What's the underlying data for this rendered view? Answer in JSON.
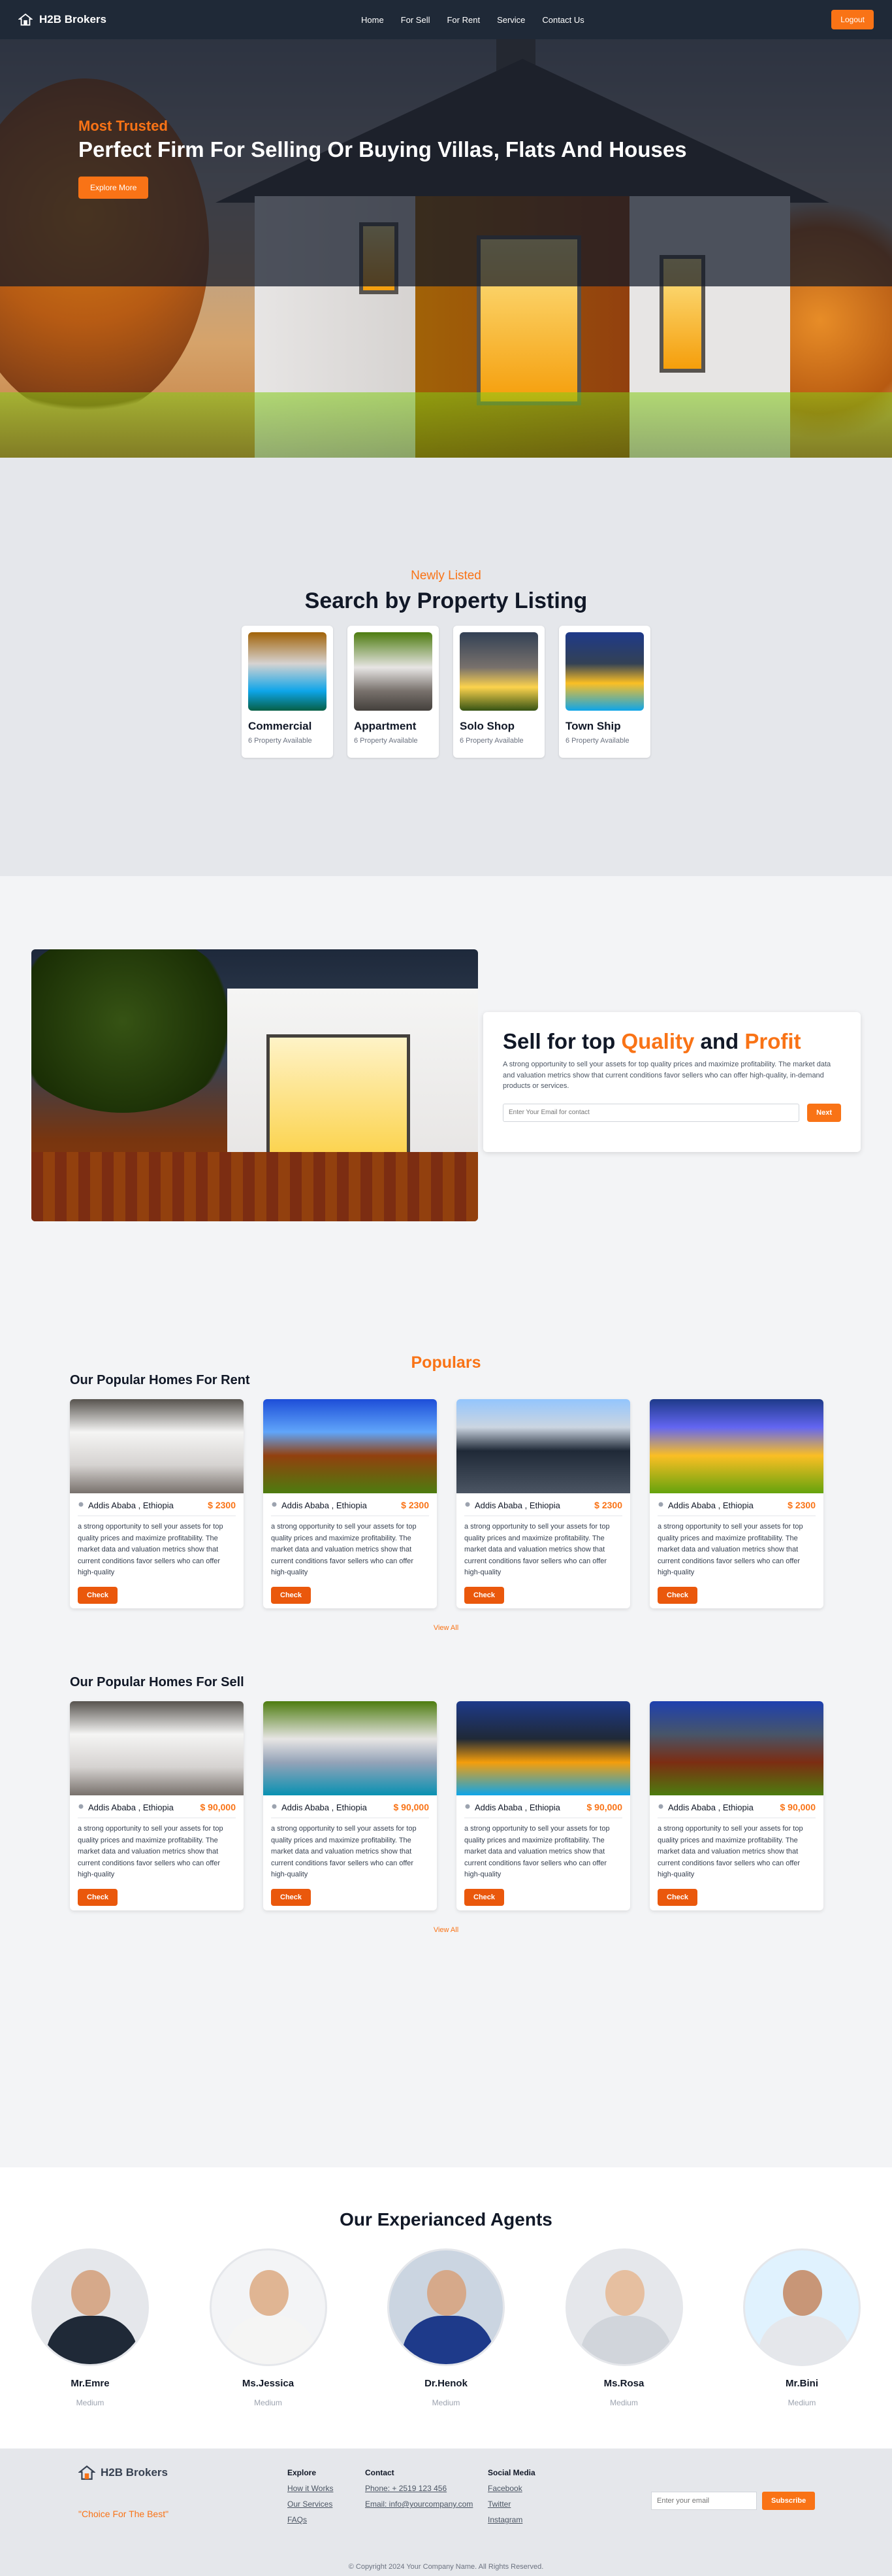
{
  "nav": {
    "brand": "H2B Brokers",
    "links": [
      "Home",
      "For Sell",
      "For Rent",
      "Service",
      "Contact Us"
    ],
    "logout": "Logout"
  },
  "hero": {
    "kicker": "Most Trusted",
    "title": "Perfect Firm For Selling Or Buying Villas, Flats And Houses",
    "cta": "Explore More"
  },
  "listing": {
    "kicker": "Newly Listed",
    "title": "Search by Property Listing",
    "categories": [
      {
        "name": "Commercial",
        "count": "6 Property Available"
      },
      {
        "name": "Appartment",
        "count": "6 Property Available"
      },
      {
        "name": "Solo Shop",
        "count": "6 Property Available"
      },
      {
        "name": "Town Ship",
        "count": "6 Property Available"
      }
    ]
  },
  "sell": {
    "title_a": "Sell for top ",
    "title_b": "Quality",
    "title_c": " and ",
    "title_d": "Profit",
    "text": "A strong opportunity to sell your assets for top quality prices and maximize profitability. The market data and valuation metrics show that current conditions favor sellers who can offer high-quality, in-demand products or services.",
    "placeholder": "Enter Your Email for contact",
    "button": "Next"
  },
  "populars": {
    "title": "Populars",
    "rent_title": "Our Popular Homes For Rent",
    "sell_title": "Our Popular Homes For Sell",
    "view_all": "View All",
    "desc": "a strong opportunity to sell your assets for top quality prices and maximize profitability. The market data and valuation metrics show that current conditions favor sellers who can offer high-quality",
    "check": "Check",
    "rent": [
      {
        "loc": "Addis Ababa , Ethiopia",
        "price": "$ 2300"
      },
      {
        "loc": "Addis Ababa , Ethiopia",
        "price": "$ 2300"
      },
      {
        "loc": "Addis Ababa , Ethiopia",
        "price": "$ 2300"
      },
      {
        "loc": "Addis Ababa , Ethiopia",
        "price": "$ 2300"
      }
    ],
    "sale": [
      {
        "loc": "Addis Ababa , Ethiopia",
        "price": "$ 90,000"
      },
      {
        "loc": "Addis Ababa , Ethiopia",
        "price": "$ 90,000"
      },
      {
        "loc": "Addis Ababa , Ethiopia",
        "price": "$ 90,000"
      },
      {
        "loc": "Addis Ababa , Ethiopia",
        "price": "$ 90,000"
      }
    ]
  },
  "agents": {
    "title": "Our Experianced Agents",
    "list": [
      {
        "name": "Mr.Emre",
        "level": "Medium"
      },
      {
        "name": "Ms.Jessica",
        "level": "Medium"
      },
      {
        "name": "Dr.Henok",
        "level": "Medium"
      },
      {
        "name": "Ms.Rosa",
        "level": "Medium"
      },
      {
        "name": "Mr.Bini",
        "level": "Medium"
      }
    ]
  },
  "footer": {
    "brand": "H2B Brokers",
    "slogan": "\"Choice For The Best\"",
    "explore_title": "Explore",
    "explore": [
      "How it Works",
      "Our Services",
      "FAQs"
    ],
    "contact_title": "Contact",
    "contact": [
      "Phone: + 2519 123 456",
      "Email: info@yourcompany.com"
    ],
    "social_title": "Social Media",
    "social": [
      "Facebook",
      "Twitter",
      "Instagram"
    ],
    "email_placeholder": "Enter your email",
    "subscribe": "Subscribe",
    "copyright": "© Copyright 2024 Your Company Name. All Rights Reserved."
  }
}
